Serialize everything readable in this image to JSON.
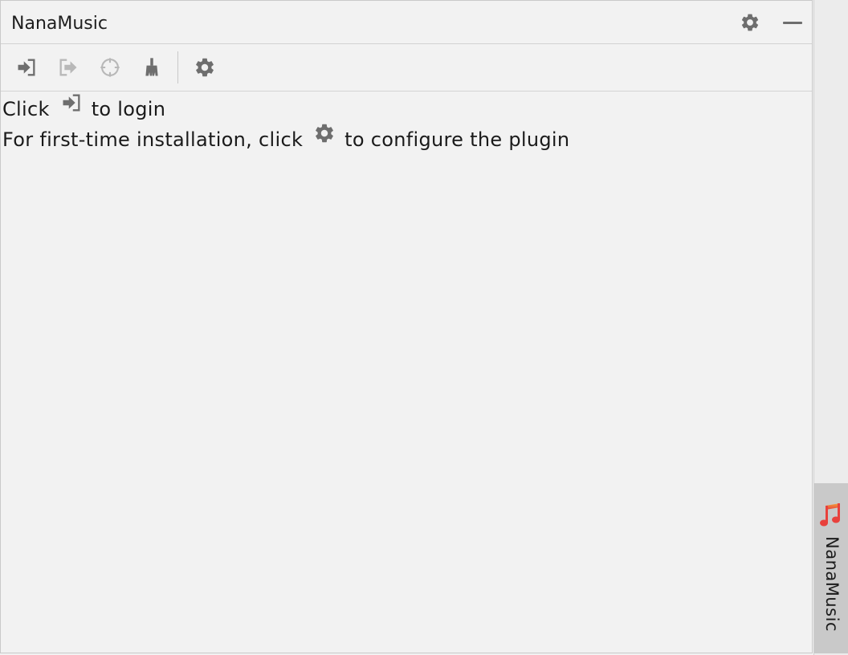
{
  "panel": {
    "title": "NanaMusic"
  },
  "header_buttons": {
    "settings_icon": "gear-icon",
    "minimize_icon": "minimize-icon"
  },
  "toolbar": {
    "buttons": [
      {
        "icon": "login-icon",
        "enabled": true
      },
      {
        "icon": "logout-icon",
        "enabled": false
      },
      {
        "icon": "target-icon",
        "enabled": false
      },
      {
        "icon": "broom-icon",
        "enabled": true
      },
      {
        "icon": "gear-icon",
        "enabled": true
      }
    ]
  },
  "content": {
    "line1_prefix": "Click",
    "line1_suffix": "to login",
    "line2_prefix": "For first-time installation, click",
    "line2_suffix": "to configure the plugin"
  },
  "sidebar": {
    "tab_label": "NanaMusic",
    "tab_icon": "music-note-icon"
  },
  "colors": {
    "icon_active": "#6e6e6e",
    "icon_disabled": "#b8b8b8",
    "music_icon": "#e8413c"
  }
}
